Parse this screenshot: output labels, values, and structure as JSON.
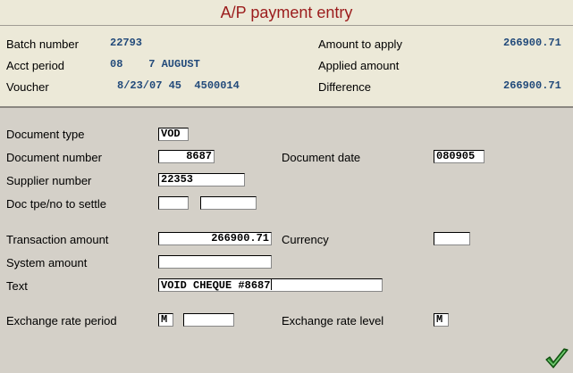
{
  "title": "A/P payment entry",
  "header": {
    "batch_number_label": "Batch number",
    "batch_number": "22793",
    "acct_period_label": "Acct period",
    "acct_period": "08    7 AUGUST",
    "voucher_label": "Voucher",
    "voucher": "8/23/07 45  4500014",
    "amount_to_apply_label": "Amount to apply",
    "amount_to_apply": "266900.71",
    "applied_amount_label": "Applied amount",
    "applied_amount": "",
    "difference_label": "Difference",
    "difference": "266900.71"
  },
  "form": {
    "document_type_label": "Document type",
    "document_type": "VOD",
    "document_number_label": "Document number",
    "document_number": "8687",
    "document_date_label": "Document date",
    "document_date": "080905",
    "supplier_number_label": "Supplier number",
    "supplier_number": "22353",
    "doc_tpe_no_label": "Doc tpe/no to settle",
    "doc_tpe": "",
    "doc_no": "",
    "transaction_amount_label": "Transaction amount",
    "transaction_amount": "266900.71",
    "currency_label": "Currency",
    "currency": "",
    "system_amount_label": "System amount",
    "system_amount": "",
    "text_label": "Text",
    "text": "VOID CHEQUE #8687",
    "exchange_rate_period_label": "Exchange rate period",
    "exchange_rate_period_code": "M",
    "exchange_rate_period": "",
    "exchange_rate_level_label": "Exchange rate level",
    "exchange_rate_level": "M"
  },
  "icons": {
    "confirm": "checkmark-icon"
  },
  "colors": {
    "title": "#9b1c1c",
    "value": "#224a7a",
    "background": "#d4d0c8"
  }
}
